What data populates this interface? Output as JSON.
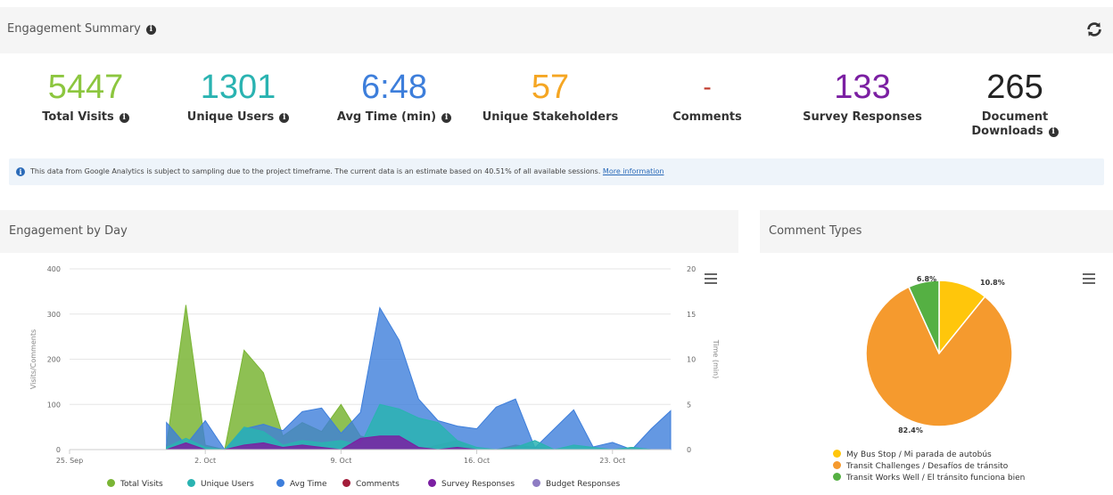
{
  "summary": {
    "title": "Engagement Summary",
    "metrics": [
      {
        "value": "5447",
        "label": "Total Visits",
        "color": "#8cc63f",
        "info": true
      },
      {
        "value": "1301",
        "label": "Unique Users",
        "color": "#2ab3b1",
        "info": true
      },
      {
        "value": "6:48",
        "label": "Avg Time (min)",
        "color": "#3d7edb",
        "info": true
      },
      {
        "value": "57",
        "label": "Unique Stakeholders",
        "color": "#f5a623",
        "info": false
      },
      {
        "value": "-",
        "label": "Comments",
        "color": "#c0392b",
        "info": false
      },
      {
        "value": "133",
        "label": "Survey Responses",
        "color": "#7b1fa2",
        "info": false
      },
      {
        "value": "265",
        "label": "Document Downloads",
        "label_line1": "Document",
        "label_line2": "Downloads",
        "color": "#222222",
        "info": true
      }
    ],
    "notice_text": "This data from Google Analytics is subject to sampling due to the project timeframe. The current data is an estimate based on 40.51% of all available sessions.",
    "notice_link": "More information"
  },
  "engagement": {
    "title": "Engagement by Day"
  },
  "comment_types": {
    "title": "Comment Types"
  },
  "chart_data": [
    {
      "type": "area",
      "x_dates": [
        "Sep 25",
        "Sep 26",
        "Sep 27",
        "Sep 28",
        "Sep 29",
        "Sep 30",
        "Oct 1",
        "Oct 2",
        "Oct 3",
        "Oct 4",
        "Oct 5",
        "Oct 6",
        "Oct 7",
        "Oct 8",
        "Oct 9",
        "Oct 10",
        "Oct 11",
        "Oct 12",
        "Oct 13",
        "Oct 14",
        "Oct 15",
        "Oct 16",
        "Oct 17",
        "Oct 18",
        "Oct 19",
        "Oct 20",
        "Oct 21",
        "Oct 22",
        "Oct 23",
        "Oct 24",
        "Oct 25",
        "Oct 26"
      ],
      "x_ticks": [
        "25. Sep",
        "2. Oct",
        "9. Oct",
        "16. Oct",
        "23. Oct"
      ],
      "ylabel": "Visits/Comments",
      "y2label": "Time (min)",
      "ylim": [
        0,
        400
      ],
      "y2lim": [
        0,
        20
      ],
      "y_ticks": [
        "0",
        "100",
        "200",
        "300",
        "400"
      ],
      "y2_ticks": [
        "0",
        "5",
        "10",
        "15",
        "20"
      ],
      "legend_position": "bottom",
      "series": [
        {
          "name": "Total Visits",
          "color": "#7ab535",
          "axis": "left",
          "values": [
            null,
            null,
            null,
            null,
            null,
            10,
            320,
            10,
            0,
            220,
            170,
            30,
            60,
            40,
            100,
            30,
            20,
            10,
            0,
            10,
            20,
            0,
            0,
            10,
            5,
            0,
            0,
            0,
            0,
            5,
            0,
            0
          ]
        },
        {
          "name": "Unique Users",
          "color": "#2ab3b1",
          "axis": "left",
          "values": [
            null,
            null,
            null,
            null,
            null,
            5,
            25,
            5,
            0,
            50,
            40,
            10,
            20,
            15,
            20,
            10,
            100,
            90,
            70,
            60,
            20,
            5,
            0,
            5,
            20,
            0,
            10,
            5,
            0,
            5,
            0,
            0
          ]
        },
        {
          "name": "Avg Time",
          "color": "#3d7edb",
          "axis": "right",
          "values": [
            null,
            null,
            null,
            null,
            null,
            3,
            0.5,
            3.2,
            0,
            2.3,
            2.8,
            2.1,
            4.2,
            4.6,
            1.8,
            4.1,
            15.7,
            12.1,
            5.6,
            3.2,
            2.6,
            2.3,
            4.7,
            5.6,
            0.2,
            2.3,
            4.4,
            0.3,
            0.8,
            0,
            2.3,
            4.3,
            2.1,
            0
          ]
        },
        {
          "name": "Comments",
          "color": "#a31d3a",
          "axis": "left",
          "values": [
            null,
            null,
            null,
            null,
            null,
            0,
            0,
            0,
            0,
            0,
            0,
            0,
            0,
            0,
            0,
            0,
            0,
            0,
            0,
            0,
            0,
            0,
            0,
            0,
            0,
            0,
            0,
            0,
            0,
            0,
            0,
            0
          ]
        },
        {
          "name": "Survey Responses",
          "color": "#7b1fa2",
          "axis": "left",
          "values": [
            null,
            null,
            null,
            null,
            null,
            0,
            15,
            0,
            0,
            10,
            15,
            5,
            10,
            5,
            0,
            25,
            30,
            30,
            5,
            0,
            5,
            0,
            0,
            0,
            0,
            0,
            0,
            0,
            0,
            0,
            0,
            0
          ]
        },
        {
          "name": "Budget Responses",
          "color": "#8e7cc3",
          "axis": "left",
          "values": [
            null,
            null,
            null,
            null,
            null,
            0,
            0,
            0,
            0,
            0,
            0,
            0,
            0,
            0,
            0,
            0,
            0,
            0,
            0,
            0,
            0,
            0,
            0,
            0,
            0,
            0,
            0,
            0,
            0,
            0,
            0,
            0
          ]
        }
      ]
    },
    {
      "type": "pie",
      "slices": [
        {
          "label": "My Bus Stop / Mi parada de autobús",
          "value": 10.8,
          "value_label": "10.8%",
          "color": "#ffc60b"
        },
        {
          "label": "Transit Challenges / Desafíos de tránsito",
          "value": 82.4,
          "value_label": "82.4%",
          "color": "#f59a2e"
        },
        {
          "label": "Transit Works Well / El tránsito funciona bien",
          "value": 6.8,
          "value_label": "6.8%",
          "color": "#55b043"
        }
      ],
      "legend_position": "bottom"
    }
  ]
}
